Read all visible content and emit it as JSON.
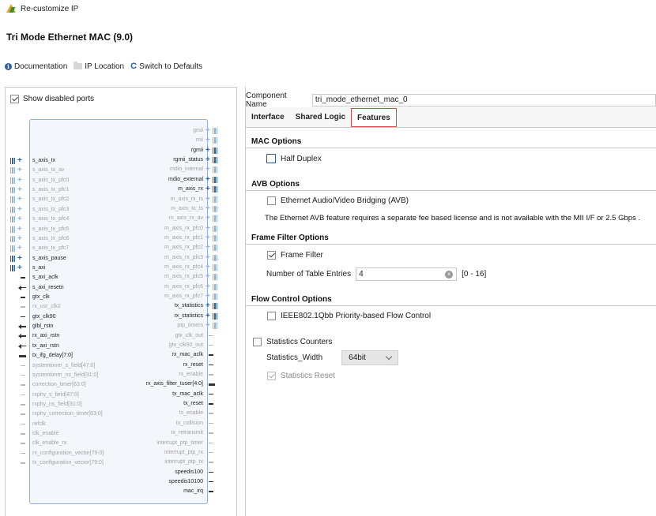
{
  "window": {
    "title": "Re-customize IP"
  },
  "product": {
    "title": "Tri Mode Ethernet MAC (9.0)"
  },
  "toolbar": {
    "documentation": "Documentation",
    "ip_location": "IP Location",
    "switch_defaults": "Switch to Defaults"
  },
  "left": {
    "show_disabled_ports": "Show disabled ports",
    "show_disabled_checked": true,
    "left_pins": [
      {
        "label": "s_axis_tx",
        "enabled": true,
        "kind": "bus"
      },
      {
        "label": "s_axis_tx_av",
        "enabled": false,
        "kind": "bus"
      },
      {
        "label": "s_axis_tx_pfc0",
        "enabled": false,
        "kind": "bus"
      },
      {
        "label": "s_axis_tx_pfc1",
        "enabled": false,
        "kind": "bus"
      },
      {
        "label": "s_axis_tx_pfc2",
        "enabled": false,
        "kind": "bus"
      },
      {
        "label": "s_axis_tx_pfc3",
        "enabled": false,
        "kind": "bus"
      },
      {
        "label": "s_axis_tx_pfc4",
        "enabled": false,
        "kind": "bus"
      },
      {
        "label": "s_axis_tx_pfc5",
        "enabled": false,
        "kind": "bus"
      },
      {
        "label": "s_axis_tx_pfc6",
        "enabled": false,
        "kind": "bus"
      },
      {
        "label": "s_axis_tx_pfc7",
        "enabled": false,
        "kind": "bus"
      },
      {
        "label": "s_axis_pause",
        "enabled": true,
        "kind": "bus"
      },
      {
        "label": "s_axi",
        "enabled": true,
        "kind": "bus"
      },
      {
        "label": "s_axi_aclk",
        "enabled": true,
        "kind": "wire"
      },
      {
        "label": "s_axi_resetn",
        "enabled": true,
        "kind": "arrow"
      },
      {
        "label": "gtx_clk",
        "enabled": true,
        "kind": "wire"
      },
      {
        "label": "rx_usr_clk2",
        "enabled": false,
        "kind": "wire"
      },
      {
        "label": "gtx_clk90",
        "enabled": true,
        "kind": "wire"
      },
      {
        "label": "glbl_rstn",
        "enabled": true,
        "kind": "arrow"
      },
      {
        "label": "rx_axi_rstn",
        "enabled": true,
        "kind": "arrow"
      },
      {
        "label": "tx_axi_rstn",
        "enabled": true,
        "kind": "arrow"
      },
      {
        "label": "tx_ifg_delay[7:0]",
        "enabled": true,
        "kind": "thick"
      },
      {
        "label": "systemtimer_s_field[47:0]",
        "enabled": false,
        "kind": "wire"
      },
      {
        "label": "systemtimer_ns_field[31:0]",
        "enabled": false,
        "kind": "wire"
      },
      {
        "label": "correction_timer[63:0]",
        "enabled": false,
        "kind": "wire"
      },
      {
        "label": "rxphy_s_field[47:0]",
        "enabled": false,
        "kind": "wire"
      },
      {
        "label": "rxphy_ns_field[31:0]",
        "enabled": false,
        "kind": "wire"
      },
      {
        "label": "rxphy_correction_timer[63:0]",
        "enabled": false,
        "kind": "wire"
      },
      {
        "label": "refclk",
        "enabled": false,
        "kind": "wire"
      },
      {
        "label": "clk_enable",
        "enabled": false,
        "kind": "wire"
      },
      {
        "label": "clk_enable_rx",
        "enabled": false,
        "kind": "wire"
      },
      {
        "label": "rx_configuration_vector[79:0]",
        "enabled": false,
        "kind": "wire"
      },
      {
        "label": "tx_configuration_vector[79:0]",
        "enabled": false,
        "kind": "wire"
      }
    ],
    "right_pins": [
      {
        "label": "gmii",
        "enabled": false,
        "kind": "bus"
      },
      {
        "label": "mii",
        "enabled": false,
        "kind": "bus"
      },
      {
        "label": "rgmii",
        "enabled": true,
        "kind": "bus"
      },
      {
        "label": "rgmii_status",
        "enabled": true,
        "kind": "bus"
      },
      {
        "label": "mdio_internal",
        "enabled": false,
        "kind": "bus"
      },
      {
        "label": "mdio_external",
        "enabled": true,
        "kind": "bus"
      },
      {
        "label": "m_axis_rx",
        "enabled": true,
        "kind": "bus"
      },
      {
        "label": "m_axis_rx_ts",
        "enabled": false,
        "kind": "bus"
      },
      {
        "label": "m_axis_tx_ts",
        "enabled": false,
        "kind": "bus"
      },
      {
        "label": "m_axis_rx_av",
        "enabled": false,
        "kind": "bus"
      },
      {
        "label": "m_axis_rx_pfc0",
        "enabled": false,
        "kind": "bus"
      },
      {
        "label": "m_axis_rx_pfc1",
        "enabled": false,
        "kind": "bus"
      },
      {
        "label": "m_axis_rx_pfc2",
        "enabled": false,
        "kind": "bus"
      },
      {
        "label": "m_axis_rx_pfc3",
        "enabled": false,
        "kind": "bus"
      },
      {
        "label": "m_axis_rx_pfc4",
        "enabled": false,
        "kind": "bus"
      },
      {
        "label": "m_axis_rx_pfc5",
        "enabled": false,
        "kind": "bus"
      },
      {
        "label": "m_axis_rx_pfc6",
        "enabled": false,
        "kind": "bus"
      },
      {
        "label": "m_axis_rx_pfc7",
        "enabled": false,
        "kind": "bus"
      },
      {
        "label": "tx_statistics",
        "enabled": true,
        "kind": "bus"
      },
      {
        "label": "rx_statistics",
        "enabled": true,
        "kind": "bus"
      },
      {
        "label": "ptp_timers",
        "enabled": false,
        "kind": "bus"
      },
      {
        "label": "gtx_clk_out",
        "enabled": false,
        "kind": "wire"
      },
      {
        "label": "gtx_clk90_out",
        "enabled": false,
        "kind": "wire"
      },
      {
        "label": "rx_mac_aclk",
        "enabled": true,
        "kind": "wire"
      },
      {
        "label": "rx_reset",
        "enabled": true,
        "kind": "wire"
      },
      {
        "label": "rx_enable",
        "enabled": false,
        "kind": "wire"
      },
      {
        "label": "rx_axis_filter_tuser[4:0]",
        "enabled": true,
        "kind": "thick"
      },
      {
        "label": "tx_mac_aclk",
        "enabled": true,
        "kind": "wire"
      },
      {
        "label": "tx_reset",
        "enabled": true,
        "kind": "wire"
      },
      {
        "label": "tx_enable",
        "enabled": false,
        "kind": "wire"
      },
      {
        "label": "tx_collision",
        "enabled": false,
        "kind": "wire"
      },
      {
        "label": "tx_retransmit",
        "enabled": false,
        "kind": "wire"
      },
      {
        "label": "interrupt_ptp_timer",
        "enabled": false,
        "kind": "wire"
      },
      {
        "label": "interrupt_ptp_rx",
        "enabled": false,
        "kind": "wire"
      },
      {
        "label": "interrupt_ptp_tx",
        "enabled": false,
        "kind": "wire"
      },
      {
        "label": "speedis100",
        "enabled": true,
        "kind": "wire"
      },
      {
        "label": "speedis10100",
        "enabled": true,
        "kind": "wire"
      },
      {
        "label": "mac_irq",
        "enabled": true,
        "kind": "wire"
      }
    ]
  },
  "right": {
    "component_name_label": "Component Name",
    "component_name_value": "tri_mode_ethernet_mac_0",
    "tabs": [
      {
        "label": "Interface",
        "active": false
      },
      {
        "label": "Shared Logic",
        "active": false
      },
      {
        "label": "Features",
        "active": true
      }
    ],
    "mac_options": {
      "title": "MAC Options",
      "half_duplex": "Half Duplex",
      "half_duplex_checked": false
    },
    "avb_options": {
      "title": "AVB Options",
      "avb_label": "Ethernet Audio/Video Bridging (AVB)",
      "avb_checked": false,
      "note": "The Ethernet AVB feature requires a separate fee based license and is not available with the MII I/F or 2.5 Gbps ."
    },
    "frame_filter": {
      "title": "Frame Filter Options",
      "frame_filter_label": "Frame Filter",
      "frame_filter_checked": true,
      "entries_label": "Number of Table Entries",
      "entries_value": "4",
      "entries_range": "[0 - 16]"
    },
    "flow_control": {
      "title": "Flow Control Options",
      "pfc_label": "IEEE802.1Qbb Priority-based Flow Control",
      "pfc_checked": false
    },
    "statistics": {
      "counters_label": "Statistics Counters",
      "counters_checked": false,
      "width_label": "Statistics_Width",
      "width_value": "64bit",
      "reset_label": "Statistics Reset",
      "reset_checked": true
    }
  }
}
